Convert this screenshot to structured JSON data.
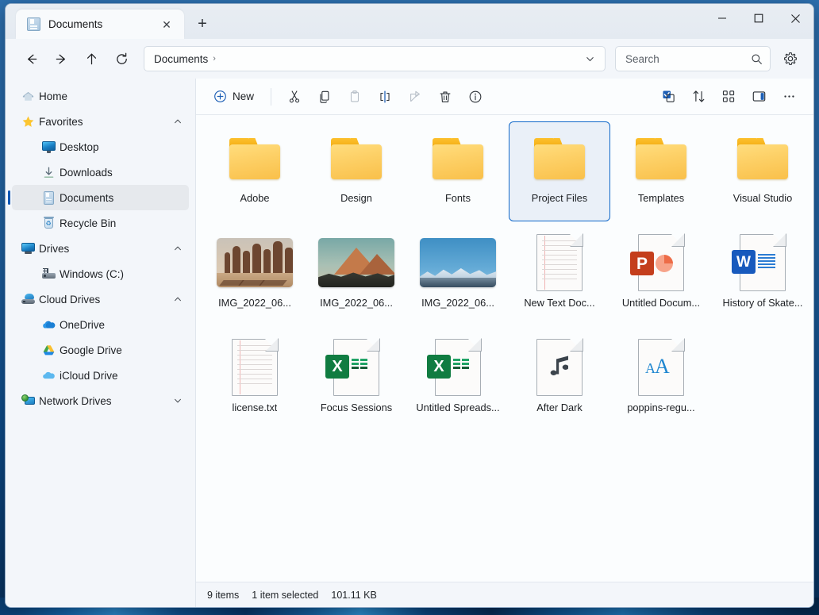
{
  "window": {
    "tab": {
      "title": "Documents",
      "icon": "document-icon",
      "close_label": "✕"
    },
    "new_tab_label": "+",
    "controls": {
      "minimize": "minimize-icon",
      "maximize": "maximize-icon",
      "close": "close-icon"
    }
  },
  "addressbar": {
    "back": "back-arrow-icon",
    "forward": "forward-arrow-icon",
    "up": "up-arrow-icon",
    "refresh": "refresh-icon",
    "breadcrumb": "Documents",
    "breadcrumb_separator": "›",
    "dropdown": "chevron-down-icon",
    "search_placeholder": "Search",
    "search_icon": "search-icon",
    "settings_icon": "gear-icon"
  },
  "sidebar": {
    "items": [
      {
        "label": "Home",
        "icon": "home-icon",
        "level": 0,
        "chevron": "",
        "selected": false
      },
      {
        "label": "Favorites",
        "icon": "star-icon",
        "level": 0,
        "chevron": "⌃",
        "selected": false
      },
      {
        "label": "Desktop",
        "icon": "desktop-icon",
        "level": 1,
        "chevron": "",
        "selected": false
      },
      {
        "label": "Downloads",
        "icon": "download-icon",
        "level": 1,
        "chevron": "",
        "selected": false
      },
      {
        "label": "Documents",
        "icon": "documents-icon",
        "level": 1,
        "chevron": "",
        "selected": true
      },
      {
        "label": "Recycle Bin",
        "icon": "recycle-bin-icon",
        "level": 1,
        "chevron": "",
        "selected": false
      },
      {
        "label": "Drives",
        "icon": "monitor-icon",
        "level": 0,
        "chevron": "⌃",
        "selected": false
      },
      {
        "label": "Windows (C:)",
        "icon": "harddisk-icon",
        "level": 1,
        "chevron": "",
        "selected": false
      },
      {
        "label": "Cloud Drives",
        "icon": "cloud-drive-icon",
        "level": 0,
        "chevron": "⌃",
        "selected": false
      },
      {
        "label": "OneDrive",
        "icon": "onedrive-icon",
        "level": 1,
        "chevron": "",
        "selected": false
      },
      {
        "label": "Google Drive",
        "icon": "google-drive-icon",
        "level": 1,
        "chevron": "",
        "selected": false
      },
      {
        "label": "iCloud Drive",
        "icon": "icloud-icon",
        "level": 1,
        "chevron": "",
        "selected": false
      },
      {
        "label": "Network Drives",
        "icon": "network-drive-icon",
        "level": 0,
        "chevron": "⌄",
        "selected": false
      }
    ]
  },
  "toolbar": {
    "new_label": "New",
    "new_icon": "plus-circle-icon",
    "buttons": [
      {
        "name": "cut-button",
        "icon": "scissors-icon",
        "dim": false
      },
      {
        "name": "copy-button",
        "icon": "copy-icon",
        "dim": false
      },
      {
        "name": "paste-button",
        "icon": "paste-icon",
        "dim": true
      },
      {
        "name": "rename-button",
        "icon": "rename-icon",
        "dim": false
      },
      {
        "name": "share-button",
        "icon": "share-icon",
        "dim": true
      },
      {
        "name": "delete-button",
        "icon": "trash-icon",
        "dim": false
      },
      {
        "name": "properties-button",
        "icon": "info-icon",
        "dim": false
      }
    ],
    "right_buttons": [
      {
        "name": "select-all-button",
        "icon": "select-check-icon"
      },
      {
        "name": "sort-button",
        "icon": "sort-arrows-icon"
      },
      {
        "name": "view-button",
        "icon": "view-grid-icon"
      },
      {
        "name": "layout-pane-button",
        "icon": "details-pane-icon"
      },
      {
        "name": "more-options-button",
        "icon": "ellipsis-icon"
      }
    ]
  },
  "files": [
    {
      "name": "Adobe",
      "type": "folder",
      "selected": false
    },
    {
      "name": "Design",
      "type": "folder",
      "selected": false
    },
    {
      "name": "Fonts",
      "type": "folder",
      "selected": false
    },
    {
      "name": "Project Files",
      "type": "folder",
      "selected": true
    },
    {
      "name": "Templates",
      "type": "folder",
      "selected": false
    },
    {
      "name": "Visual Studio",
      "type": "folder",
      "selected": false
    },
    {
      "name": "IMG_2022_06...",
      "type": "photo-desert",
      "selected": false
    },
    {
      "name": "IMG_2022_06...",
      "type": "photo-peak",
      "selected": false
    },
    {
      "name": "IMG_2022_06...",
      "type": "photo-snow",
      "selected": false
    },
    {
      "name": "New Text Doc...",
      "type": "text",
      "selected": false
    },
    {
      "name": "Untitled Docum...",
      "type": "powerpoint",
      "selected": false
    },
    {
      "name": "History of Skate...",
      "type": "word",
      "selected": false
    },
    {
      "name": "license.txt",
      "type": "text",
      "selected": false
    },
    {
      "name": "Focus Sessions",
      "type": "excel",
      "selected": false
    },
    {
      "name": "Untitled Spreads...",
      "type": "excel",
      "selected": false
    },
    {
      "name": "After Dark",
      "type": "music",
      "selected": false
    },
    {
      "name": "poppins-regu...",
      "type": "font",
      "selected": false
    }
  ],
  "statusbar": {
    "item_count": "9 items",
    "selection": "1 item selected",
    "size": "101.11 KB"
  },
  "colors": {
    "accent": "#1168c9",
    "selection_bg": "#eaf0f8",
    "folder_yellow": "#fdd066",
    "window_bg": "#f3f6fa"
  }
}
